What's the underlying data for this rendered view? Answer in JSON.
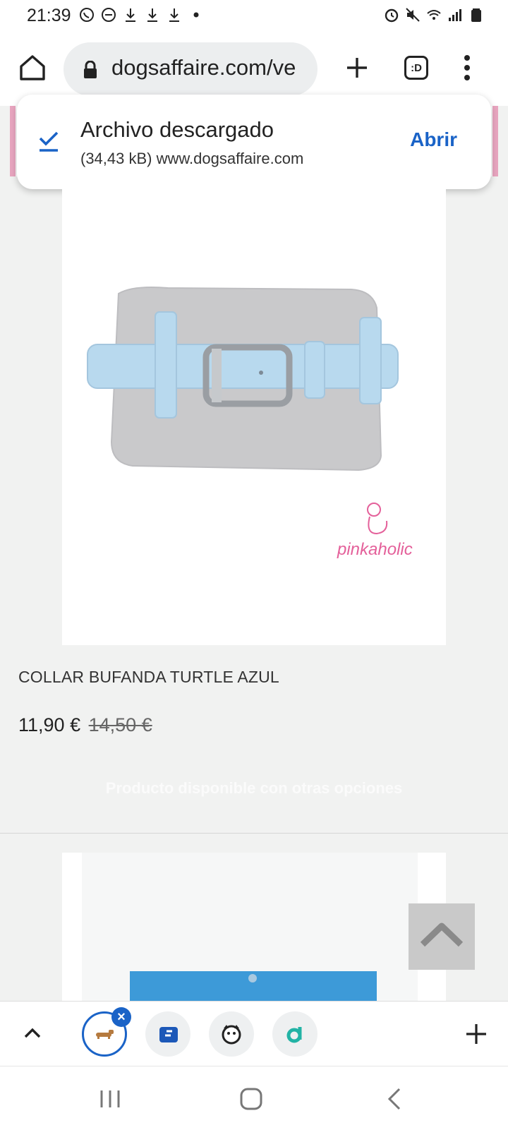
{
  "status_bar": {
    "time": "21:39",
    "left_icons": [
      "whatsapp-icon",
      "dnd-icon",
      "download-icon",
      "download-icon",
      "download-icon",
      "dot-icon"
    ],
    "right_icons": [
      "alarm-icon",
      "mute-icon",
      "wifi-icon",
      "signal-icon",
      "battery-icon"
    ]
  },
  "browser": {
    "url": "dogsaffaire.com/ve",
    "tab_button_label": ":D"
  },
  "download_toast": {
    "title": "Archivo descargado",
    "subtitle": "(34,43 kB) www.dogsaffaire.com",
    "action_label": "Abrir"
  },
  "product": {
    "name": "COLLAR BUFANDA TURTLE AZUL",
    "price_current": "11,90 €",
    "price_old": "14,50 €",
    "availability": "Producto disponible con otras opciones",
    "image_brand_logo": "pinkaholic",
    "colors": {
      "collar": "#b8d9ee",
      "scarf": "#c9c9cb",
      "logo": "#e4609a"
    }
  },
  "tab_strip": {
    "tabs": [
      {
        "icon": "dachshund-icon",
        "active": true
      },
      {
        "icon": "g-logo-icon",
        "active": false
      },
      {
        "icon": "dog-face-icon",
        "active": false
      },
      {
        "icon": "teal-d-icon",
        "active": false
      }
    ]
  },
  "colors": {
    "accent": "#1a63c7",
    "pink_header": "#e8a5bf",
    "page_bg": "#f1f2f1"
  }
}
